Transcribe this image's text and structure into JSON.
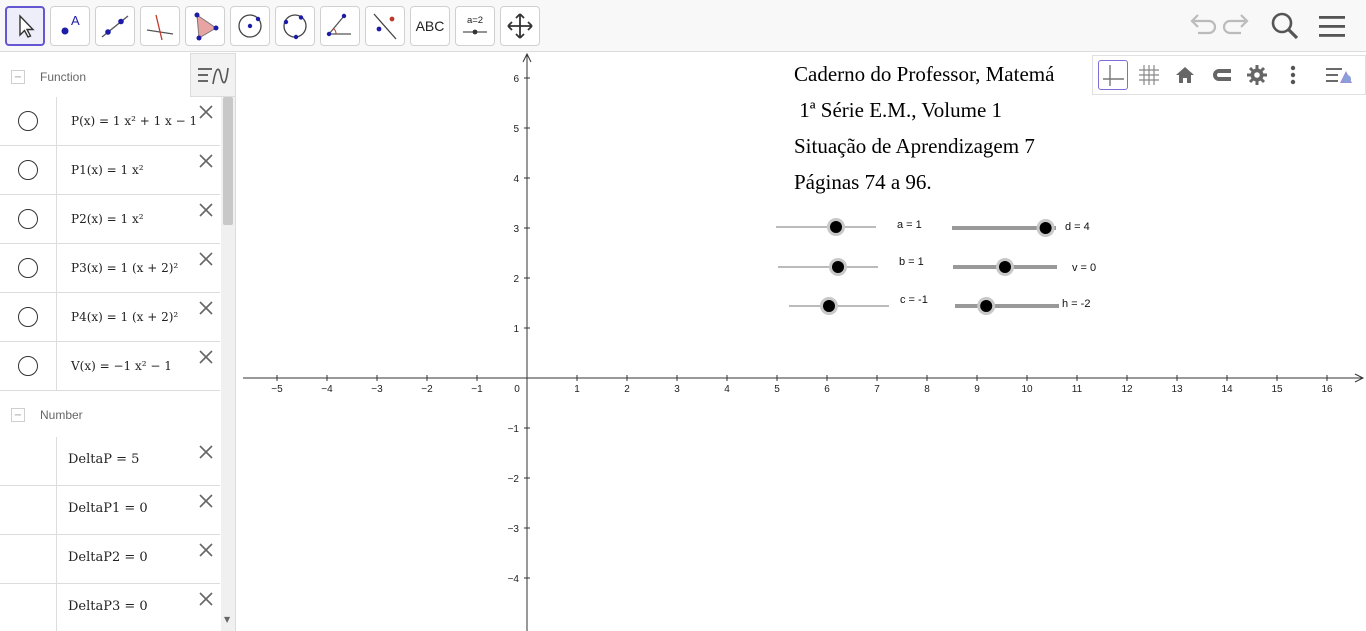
{
  "toolbar": {
    "tools": [
      {
        "name": "move-tool",
        "label": ""
      },
      {
        "name": "point-tool",
        "label": ""
      },
      {
        "name": "line-tool",
        "label": ""
      },
      {
        "name": "perpendicular-tool",
        "label": ""
      },
      {
        "name": "polygon-tool",
        "label": ""
      },
      {
        "name": "circle-center-tool",
        "label": ""
      },
      {
        "name": "circle-three-points-tool",
        "label": ""
      },
      {
        "name": "angle-tool",
        "label": ""
      },
      {
        "name": "reflect-tool",
        "label": ""
      },
      {
        "name": "text-tool",
        "label": "ABC"
      },
      {
        "name": "slider-tool",
        "label": "a = 2"
      },
      {
        "name": "move-graphics-tool",
        "label": ""
      }
    ],
    "right_icons": [
      "undo-icon",
      "redo-icon",
      "search-icon",
      "menu-icon"
    ]
  },
  "algebra": {
    "groups": {
      "function": "Function",
      "number": "Number"
    },
    "functions": [
      {
        "name": "P",
        "expr": "P(x) = 1 x² + 1 x − 1"
      },
      {
        "name": "P1",
        "expr": "P1(x) = 1 x²"
      },
      {
        "name": "P2",
        "expr": "P2(x) = 1 x²"
      },
      {
        "name": "P3",
        "expr": "P3(x) = 1 (x + 2)²"
      },
      {
        "name": "P4",
        "expr": "P4(x) = 1 (x + 2)²"
      },
      {
        "name": "V",
        "expr": "V(x) = −1 x² − 1"
      }
    ],
    "numbers": [
      {
        "expr": "DeltaP = 5"
      },
      {
        "expr": "DeltaP1 = 0"
      },
      {
        "expr": "DeltaP2 = 0"
      },
      {
        "expr": "DeltaP3 = 0"
      }
    ]
  },
  "graphics_toolbar": [
    "axes-icon",
    "grid-icon",
    "home-icon",
    "magnet-icon",
    "settings-icon",
    "more-icon",
    "style-bar-icon"
  ],
  "canvas_text": [
    "Caderno do Professor, Matemá",
    " 1ª Série E.M., Volume 1",
    "Situação de Aprendizagem 7",
    "Páginas 74 a 96."
  ],
  "sliders": [
    {
      "name": "a",
      "label": "a = 1",
      "value": 1,
      "min": -5,
      "max": 5
    },
    {
      "name": "b",
      "label": "b = 1",
      "value": 1,
      "min": -5,
      "max": 5
    },
    {
      "name": "c",
      "label": "c = -1",
      "value": -1,
      "min": -5,
      "max": 5
    },
    {
      "name": "d",
      "label": "d = 4",
      "value": 4,
      "min": -5,
      "max": 5
    },
    {
      "name": "v",
      "label": "v = 0",
      "value": 0,
      "min": -5,
      "max": 5
    },
    {
      "name": "h",
      "label": "h = -2",
      "value": -2,
      "min": -5,
      "max": 5
    }
  ],
  "axes": {
    "x_ticks": [
      "−5",
      "−4",
      "−3",
      "−2",
      "−1",
      "0",
      "1",
      "2",
      "3",
      "4",
      "5",
      "6",
      "7",
      "8",
      "9",
      "10",
      "11",
      "12",
      "13",
      "14",
      "15",
      "16"
    ],
    "y_ticks": [
      "6",
      "5",
      "4",
      "3",
      "2",
      "1",
      "−1",
      "−2",
      "−3",
      "−4"
    ],
    "xlim": [
      -5.3,
      16.7
    ],
    "ylim": [
      -5,
      6.5
    ]
  }
}
